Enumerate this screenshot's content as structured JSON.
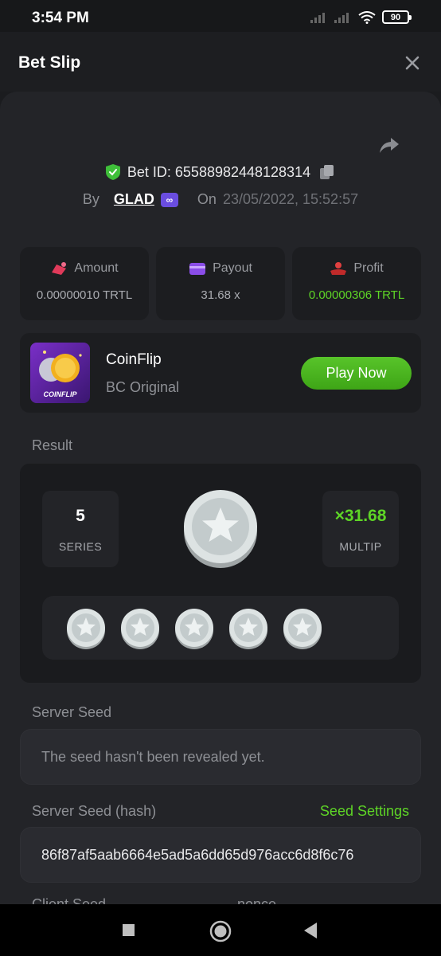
{
  "status_bar": {
    "time": "3:54 PM",
    "battery": "90"
  },
  "header": {
    "title": "Bet Slip"
  },
  "bet": {
    "id_label": "Bet ID: 65588982448128314",
    "by_label": "By",
    "user": "GLAD",
    "vip_badge": "∞",
    "on_label": "On",
    "datetime": "23/05/2022, 15:52:57"
  },
  "stats": [
    {
      "label": "Amount",
      "value": "0.00000010 TRTL",
      "icon": "money-icon",
      "color": "#e03a5a"
    },
    {
      "label": "Payout",
      "value": "31.68 x",
      "icon": "wallet-icon",
      "color": "#8a4de8"
    },
    {
      "label": "Profit",
      "value": "0.00000306 TRTL",
      "icon": "profit-icon",
      "color": "#e04040"
    }
  ],
  "game": {
    "name": "CoinFlip",
    "subtitle": "BC Original",
    "thumb_label": "COINFLIP",
    "play_label": "Play Now"
  },
  "result": {
    "section_label": "Result",
    "series_value": "5",
    "series_label": "SERIES",
    "multiplier_value": "×31.68",
    "multiplier_label": "MULTIP",
    "coins": 5
  },
  "server_seed": {
    "label": "Server Seed",
    "value": "The seed hasn't been revealed yet."
  },
  "server_seed_hash": {
    "label": "Server Seed (hash)",
    "link": "Seed Settings",
    "value": "86f87af5aab6664e5ad5a6dd65d976acc6d8f6c76"
  },
  "client_seed": {
    "label": "Client Seed"
  },
  "nonce": {
    "label": "nonce"
  },
  "colors": {
    "accent_green": "#5ed526",
    "background": "#232428",
    "card": "#1c1d20"
  }
}
